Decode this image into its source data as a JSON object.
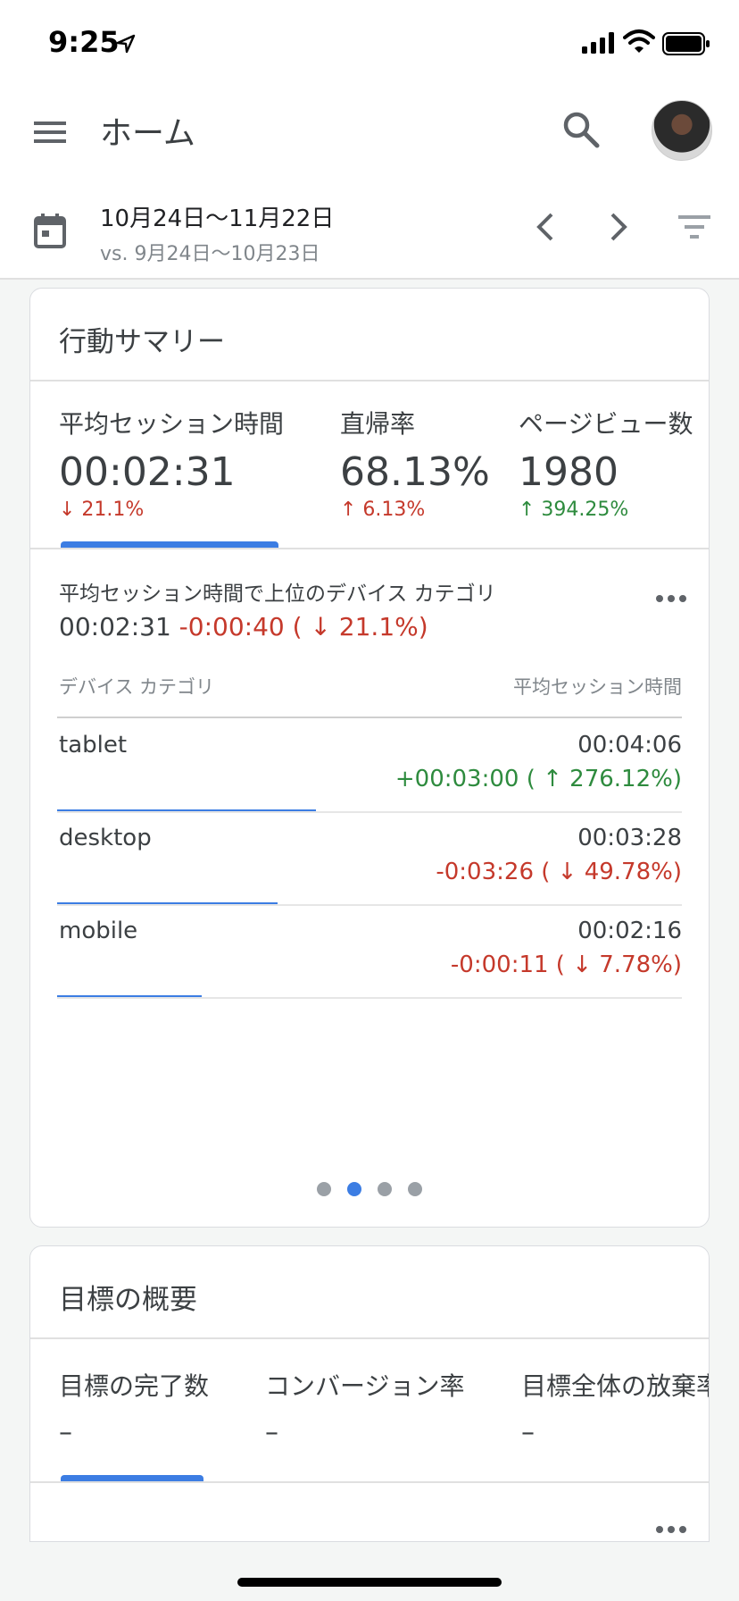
{
  "status": {
    "time": "9:25"
  },
  "appbar": {
    "title": "ホーム"
  },
  "datebar": {
    "range": "10月24日〜11月22日",
    "compare": "vs. 9月24日〜10月23日"
  },
  "behavior": {
    "title": "行動サマリー",
    "metrics": [
      {
        "label": "平均セッション時間",
        "value": "00:02:31",
        "change": "↓ 21.1%"
      },
      {
        "label": "直帰率",
        "value": "68.13%",
        "change": "↑ 6.13%"
      },
      {
        "label": "ページビュー数",
        "value": "1980",
        "change": "↑ 394.25%"
      }
    ],
    "detail": {
      "title": "平均セッション時間で上位のデバイス カテゴリ",
      "value": "00:02:31",
      "delta": "-0:00:40 ( ↓ 21.1%)",
      "col_left": "デバイス カテゴリ",
      "col_right": "平均セッション時間",
      "rows": [
        {
          "name": "tablet",
          "value": "00:04:06",
          "change": "+00:03:00 ( ↑ 276.12%)",
          "bar_fraction": 1.0
        },
        {
          "name": "desktop",
          "value": "00:03:28",
          "change": "-0:03:26 ( ↓ 49.78%)",
          "bar_fraction": 0.85
        },
        {
          "name": "mobile",
          "value": "00:02:16",
          "change": "-0:00:11 ( ↓ 7.78%)",
          "bar_fraction": 0.56
        }
      ]
    },
    "pager": {
      "count": 4,
      "active": 2
    }
  },
  "goals": {
    "title": "目標の概要",
    "metrics": [
      {
        "label": "目標の完了数",
        "value": "–"
      },
      {
        "label": "コンバージョン率",
        "value": "–"
      },
      {
        "label": "目標全体の放棄率",
        "value": "–"
      }
    ]
  },
  "colors": {
    "accent": "#3c7de3",
    "negative": "#c5392b",
    "positive": "#2e8b3e"
  }
}
